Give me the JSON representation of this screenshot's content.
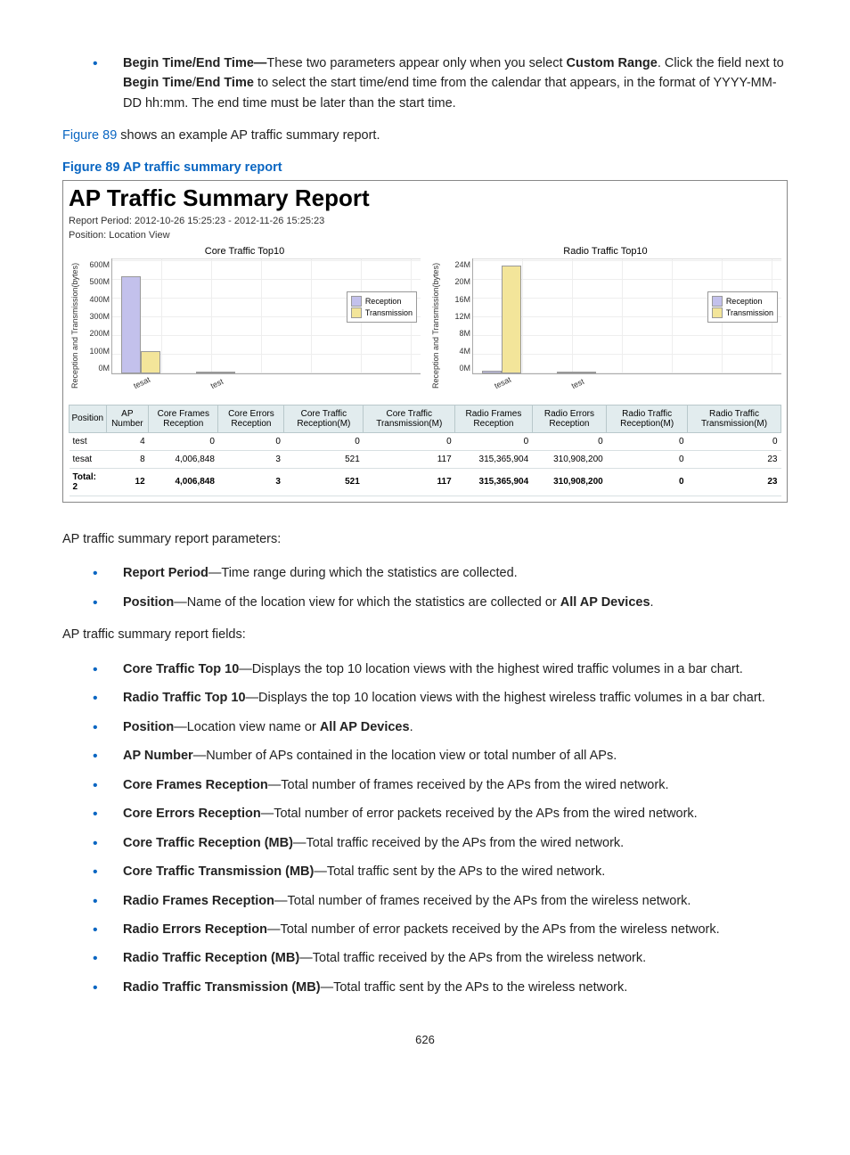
{
  "top_bullet": {
    "term": "Begin Time/End Time—",
    "rest_1": "These two parameters appear only when you select ",
    "bold_1": "Custom Range",
    "rest_2": ". Click the field next to ",
    "bold_2": "Begin Time",
    "sep": "/",
    "bold_3": "End Time",
    "rest_3": " to select the start time/end time from the calendar that appears, in the format of YYYY-MM-DD hh:mm. The end time must be later than the start time."
  },
  "figref": {
    "link": "Figure 89",
    "rest": " shows an example AP traffic summary report."
  },
  "figure_caption": "Figure 89 AP traffic summary report",
  "report": {
    "title": "AP Traffic Summary Report",
    "period_label": "Report Period: 2012-10-26 15:25:23  -  2012-11-26 15:25:23",
    "position_label": "Position: Location View",
    "ylabel": "Reception and Transmission(bytes)",
    "legend_reception": "Reception",
    "legend_transmission": "Transmission",
    "chart1_title": "Core Traffic Top10",
    "chart2_title": "Radio Traffic Top10",
    "table_headers": [
      "Position",
      "AP Number",
      "Core Frames Reception",
      "Core  Errors Reception",
      "Core Traffic Reception(M)",
      "Core Traffic Transmission(M)",
      "Radio Frames Reception",
      "Radio Errors Reception",
      "Radio Traffic Reception(M)",
      "Radio Traffic Transmission(M)"
    ],
    "rows": [
      {
        "pos": "test",
        "vals": [
          "4",
          "0",
          "0",
          "0",
          "0",
          "0",
          "0",
          "0",
          "0"
        ]
      },
      {
        "pos": "tesat",
        "vals": [
          "8",
          "4,006,848",
          "3",
          "521",
          "117",
          "315,365,904",
          "310,908,200",
          "0",
          "23"
        ]
      }
    ],
    "total_label": "Total: 2",
    "total_vals": [
      "12",
      "4,006,848",
      "3",
      "521",
      "117",
      "315,365,904",
      "310,908,200",
      "0",
      "23"
    ]
  },
  "chart_data": [
    {
      "type": "bar",
      "title": "Core Traffic Top10",
      "ylabel": "Reception and Transmission(bytes)",
      "ylim": [
        0,
        600
      ],
      "y_unit": "M",
      "y_ticks": [
        "600M",
        "500M",
        "400M",
        "300M",
        "200M",
        "100M",
        "0M"
      ],
      "categories": [
        "tesat",
        "test"
      ],
      "series": [
        {
          "name": "Reception",
          "values": [
            520,
            0
          ]
        },
        {
          "name": "Transmission",
          "values": [
            120,
            0
          ]
        }
      ]
    },
    {
      "type": "bar",
      "title": "Radio Traffic Top10",
      "ylabel": "Reception and Transmission(bytes)",
      "ylim": [
        0,
        24
      ],
      "y_unit": "M",
      "y_ticks": [
        "24M",
        "20M",
        "16M",
        "12M",
        "8M",
        "4M",
        "0M"
      ],
      "categories": [
        "tesat",
        "test"
      ],
      "series": [
        {
          "name": "Reception",
          "values": [
            0.5,
            0
          ]
        },
        {
          "name": "Transmission",
          "values": [
            23,
            0.2
          ]
        }
      ]
    }
  ],
  "params_intro": "AP traffic summary report parameters:",
  "param_bullets": [
    {
      "term": "Report Period",
      "desc": "—Time range during which the statistics are collected."
    },
    {
      "term": "Position",
      "desc_pre": "—Name of the location view for which the statistics are collected or ",
      "bold": "All AP Devices",
      "desc_post": "."
    }
  ],
  "fields_intro": "AP traffic summary report fields:",
  "field_bullets": [
    {
      "term": "Core Traffic Top 10",
      "desc": "—Displays the top 10 location views with the highest wired traffic volumes in a bar chart."
    },
    {
      "term": "Radio Traffic Top 10",
      "desc": "—Displays the top 10 location views with the highest wireless traffic volumes in a bar chart."
    },
    {
      "term": "Position",
      "desc_pre": "—Location view name or ",
      "bold": "All AP Devices",
      "desc_post": "."
    },
    {
      "term": "AP Number",
      "desc": "—Number of APs contained in the location view or total number of all APs."
    },
    {
      "term": "Core Frames Reception",
      "desc": "—Total number of frames received by the APs from the wired network."
    },
    {
      "term": "Core Errors Reception",
      "desc": "—Total number of error packets received by the APs from the wired network."
    },
    {
      "term": "Core Traffic Reception (MB)",
      "desc": "—Total traffic received by the APs from the wired network."
    },
    {
      "term": "Core Traffic Transmission (MB)",
      "desc": "—Total traffic sent by the APs to the wired network."
    },
    {
      "term": "Radio Frames Reception",
      "desc": "—Total number of frames received by the APs from the wireless network."
    },
    {
      "term": "Radio Errors Reception",
      "desc": "—Total number of error packets received by the APs from the wireless network."
    },
    {
      "term": "Radio Traffic Reception (MB)",
      "desc": "—Total traffic received by the APs from the wireless network."
    },
    {
      "term": "Radio Traffic Transmission (MB)",
      "desc": "—Total traffic sent by the APs to the wireless network."
    }
  ],
  "page_number": "626"
}
